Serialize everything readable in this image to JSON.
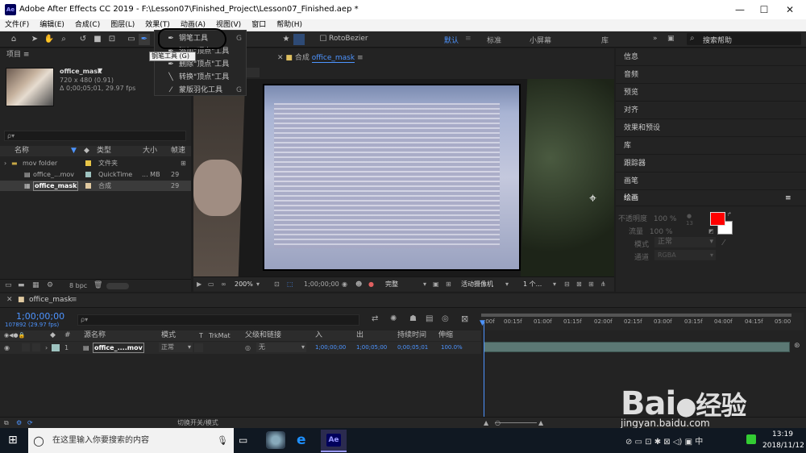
{
  "window": {
    "title": "Adobe After Effects CC 2019 - F:\\Lesson07\\Finished_Project\\Lesson07_Finished.aep *"
  },
  "menu": [
    "文件(F)",
    "编辑(E)",
    "合成(C)",
    "图层(L)",
    "效果(T)",
    "动画(A)",
    "视图(V)",
    "窗口",
    "帮助(H)"
  ],
  "toolbar": {
    "rotobezier": "RotoBezier",
    "workspaces": [
      "默认",
      "标准",
      "小屏幕",
      "库"
    ],
    "search_placeholder": "搜索帮助"
  },
  "tooltip": "钢笔工具 (G)",
  "pen_flyout": [
    {
      "label": "钢笔工具",
      "shortcut": "G",
      "icon": "pen-icon"
    },
    {
      "label": "添加\"顶点\"工具",
      "shortcut": "",
      "icon": "add-vertex-icon"
    },
    {
      "label": "删除\"顶点\"工具",
      "shortcut": "",
      "icon": "delete-vertex-icon"
    },
    {
      "label": "转换\"顶点\"工具",
      "shortcut": "",
      "icon": "convert-vertex-icon"
    },
    {
      "label": "蒙版羽化工具",
      "shortcut": "G",
      "icon": "mask-feather-icon"
    }
  ],
  "project": {
    "title": "项目",
    "item_name": "office_mask",
    "item_dims": "720 x 480 (0.91)",
    "item_duration": "Δ 0;00;05;01, 29.97 fps",
    "search_placeholder": "ρ▾",
    "columns": {
      "name": "名称",
      "type": "类型",
      "size": "大小",
      "fps": "帧速"
    },
    "rows": [
      {
        "name": "mov folder",
        "type": "文件夹",
        "size": "",
        "fps": "",
        "color": "#e8c547"
      },
      {
        "name": "office_...mov",
        "type": "QuickTime",
        "size": "... MB",
        "fps": "29",
        "color": "#9ec3c0"
      },
      {
        "name": "office_mask",
        "type": "合成",
        "size": "",
        "fps": "29",
        "color": "#e0c9a0"
      }
    ],
    "footer_bpc": "8 bpc"
  },
  "comp": {
    "tab_label": "合成",
    "tab_name": "office_mask",
    "zoom": "200%",
    "timecode": "1;00;00;00",
    "quality": "完整",
    "camera": "活动摄像机",
    "views": "1 个..."
  },
  "right_panels": [
    "信息",
    "音频",
    "预览",
    "对齐",
    "效果和预设",
    "库",
    "跟踪器",
    "画笔"
  ],
  "paint": {
    "title": "绘画",
    "opacity_label": "不透明度",
    "opacity_value": "100 %",
    "flow_label": "流量",
    "flow_value": "100 %",
    "mode_label": "模式",
    "mode_value": "正常",
    "channel_label": "通道",
    "channel_value": "RGBA",
    "fg_color": "#ff0000",
    "small_num": "13"
  },
  "timeline": {
    "tab_name": "office_mask",
    "timecode": "1;00;00;00",
    "timecode_sub": "107892 (29.97 fps)",
    "search_placeholder": "ρ▾",
    "columns": {
      "num": "#",
      "source": "源名称",
      "mode": "模式",
      "t": "T",
      "trkmat": "TrkMat",
      "parent": "父级和链接",
      "in": "入",
      "out": "出",
      "duration": "持续时间",
      "stretch": "伸缩"
    },
    "layer": {
      "num": "1",
      "name": "office_....mov",
      "mode": "正常",
      "parent": "无",
      "in": "1;00;00;00",
      "out": "1;00;05;00",
      "duration": "0;00;05;01",
      "stretch": "100.0%"
    },
    "ticks": [
      ":00f",
      "00:15f",
      "01:00f",
      "01:15f",
      "02:00f",
      "02:15f",
      "03:00f",
      "03:15f",
      "04:00f",
      "04:15f",
      "05:00"
    ],
    "footer_toggle": "切换开关/模式"
  },
  "taskbar": {
    "search_placeholder": "在这里输入你要搜索的内容",
    "time": "13:19",
    "date": "2018/11/12"
  },
  "watermark": {
    "brand": "Bai",
    "brand_cn": "经验",
    "url": "jingyan.baidu.com"
  }
}
